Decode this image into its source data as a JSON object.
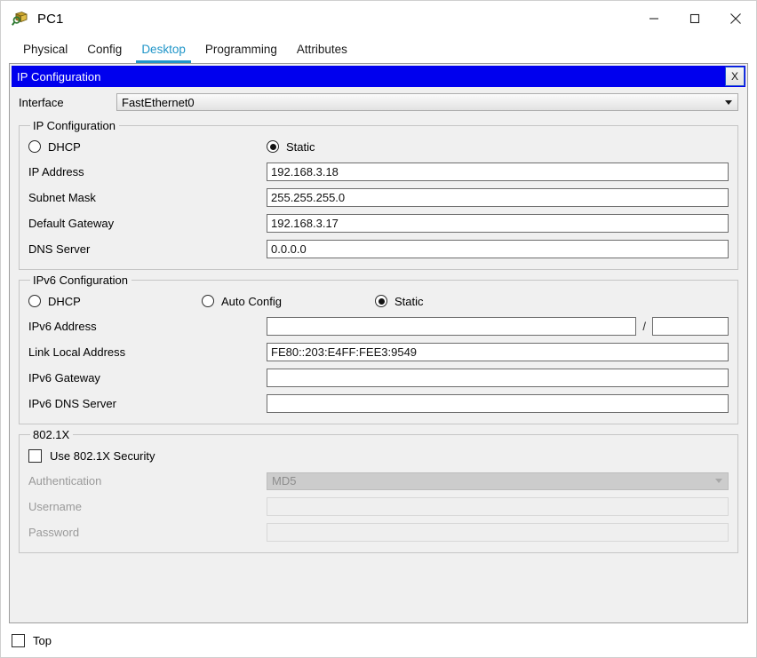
{
  "window": {
    "title": "PC1",
    "icon": "device-pc-icon",
    "controls": {
      "minimize": "minimize-icon",
      "maximize": "maximize-icon",
      "close": "close-icon"
    }
  },
  "tabs": [
    {
      "label": "Physical",
      "active": false
    },
    {
      "label": "Config",
      "active": false
    },
    {
      "label": "Desktop",
      "active": true
    },
    {
      "label": "Programming",
      "active": false
    },
    {
      "label": "Attributes",
      "active": false
    }
  ],
  "inner_window": {
    "title": "IP Configuration",
    "close_label": "X",
    "title_bg": "#0000ee",
    "title_fg": "#ffffff"
  },
  "interface": {
    "label": "Interface",
    "value": "FastEthernet0"
  },
  "ip_configuration": {
    "legend": "IP Configuration",
    "modes": [
      {
        "label": "DHCP",
        "selected": false
      },
      {
        "label": "Static",
        "selected": true
      }
    ],
    "fields": [
      {
        "label": "IP Address",
        "value": "192.168.3.18"
      },
      {
        "label": "Subnet Mask",
        "value": "255.255.255.0"
      },
      {
        "label": "Default Gateway",
        "value": "192.168.3.17"
      },
      {
        "label": "DNS Server",
        "value": "0.0.0.0"
      }
    ]
  },
  "ipv6_configuration": {
    "legend": "IPv6 Configuration",
    "modes": [
      {
        "label": "DHCP",
        "selected": false
      },
      {
        "label": "Auto Config",
        "selected": false
      },
      {
        "label": "Static",
        "selected": true
      }
    ],
    "address": {
      "label": "IPv6 Address",
      "value": "",
      "separator": "/",
      "prefix_value": ""
    },
    "fields": [
      {
        "label": "Link Local Address",
        "value": "FE80::203:E4FF:FEE3:9549"
      },
      {
        "label": "IPv6 Gateway",
        "value": ""
      },
      {
        "label": "IPv6 DNS Server",
        "value": ""
      }
    ]
  },
  "dot1x": {
    "legend": "802.1X",
    "use_security": {
      "label": "Use 802.1X Security",
      "checked": false
    },
    "authentication": {
      "label": "Authentication",
      "value": "MD5",
      "disabled": true
    },
    "username": {
      "label": "Username",
      "value": "",
      "disabled": true
    },
    "password": {
      "label": "Password",
      "value": "",
      "disabled": true
    }
  },
  "bottom": {
    "top_checkbox": {
      "label": "Top",
      "checked": false
    }
  },
  "colors": {
    "accent_tab": "#2196c9",
    "caption_blue": "#0000ee",
    "panel_bg": "#f0f0f0"
  }
}
